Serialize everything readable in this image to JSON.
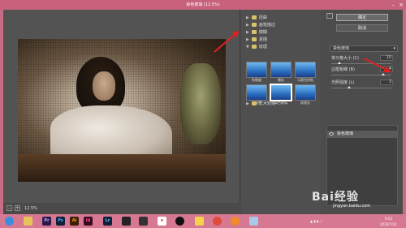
{
  "window": {
    "title": "染色玻璃 (12.5%)"
  },
  "preview": {
    "zoom": "12.5%"
  },
  "filter_tree": {
    "folders": [
      {
        "label": "扭曲"
      },
      {
        "label": "画笔描边"
      },
      {
        "label": "模糊"
      },
      {
        "label": "素描"
      },
      {
        "label": "纹理"
      },
      {
        "label": "艺术效果"
      }
    ],
    "texture_thumbs": [
      {
        "label": "龟裂缝"
      },
      {
        "label": "颗粒"
      },
      {
        "label": "马赛克拼贴"
      },
      {
        "label": "拼缀图"
      },
      {
        "label": "染色玻璃"
      },
      {
        "label": "纹理化"
      }
    ],
    "selected": "染色玻璃"
  },
  "settings": {
    "ok_label": "确定",
    "cancel_label": "取消",
    "filter_select": "染色玻璃",
    "params": [
      {
        "label": "单元格大小 (C)",
        "value": "10"
      },
      {
        "label": "边框粗细 (B)",
        "value": "4"
      },
      {
        "label": "光照强度 (L)",
        "value": "3"
      }
    ],
    "layer": "染色玻璃",
    "accent": "#4aa0e0"
  },
  "taskbar": {
    "icons": [
      "windows",
      "folder",
      "premiere",
      "photoshop",
      "illustrator",
      "indesign",
      "lightroom",
      "media",
      "video",
      "stocks",
      "qq",
      "chrome",
      "firefox",
      "files"
    ],
    "time": "9:53",
    "date": "2020/7/24"
  },
  "watermark": {
    "text": "Bai经验",
    "url": "jingyan.baidu.com"
  }
}
